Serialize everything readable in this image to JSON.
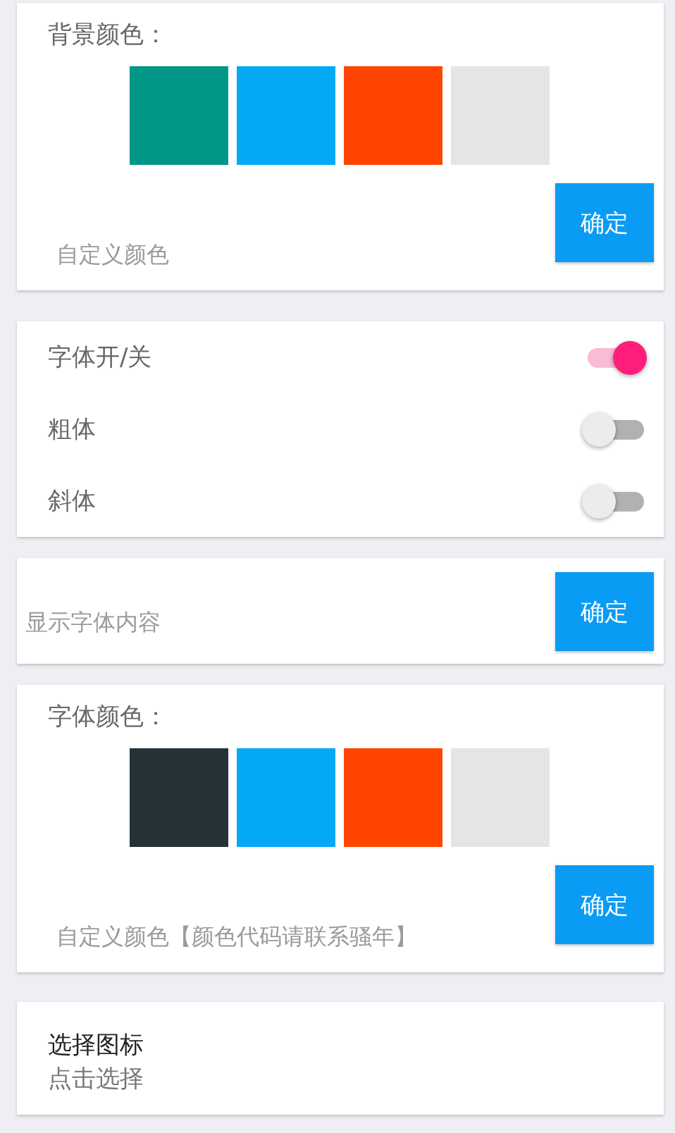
{
  "background_color": {
    "label": "背景颜色：",
    "swatches": [
      {
        "color": "#009688"
      },
      {
        "color": "#03a9f4"
      },
      {
        "color": "#ff4500"
      },
      {
        "color": "#e5e5e5"
      }
    ],
    "custom_input": {
      "placeholder": "自定义颜色"
    },
    "confirm_button": "确定"
  },
  "font_toggles": [
    {
      "label": "字体开/关",
      "on": true
    },
    {
      "label": "粗体",
      "on": false
    },
    {
      "label": "斜体",
      "on": false
    }
  ],
  "font_content": {
    "input": {
      "placeholder": "显示字体内容"
    },
    "confirm_button": "确定"
  },
  "font_color": {
    "label": "字体颜色：",
    "swatches": [
      {
        "color": "#263238"
      },
      {
        "color": "#03a9f4"
      },
      {
        "color": "#ff4500"
      },
      {
        "color": "#e5e5e5"
      }
    ],
    "custom_input": {
      "placeholder": "自定义颜色【颜色代码请联系骚年】"
    },
    "confirm_button": "确定"
  },
  "icon_picker": {
    "title": "选择图标",
    "subtitle": "点击选择"
  }
}
